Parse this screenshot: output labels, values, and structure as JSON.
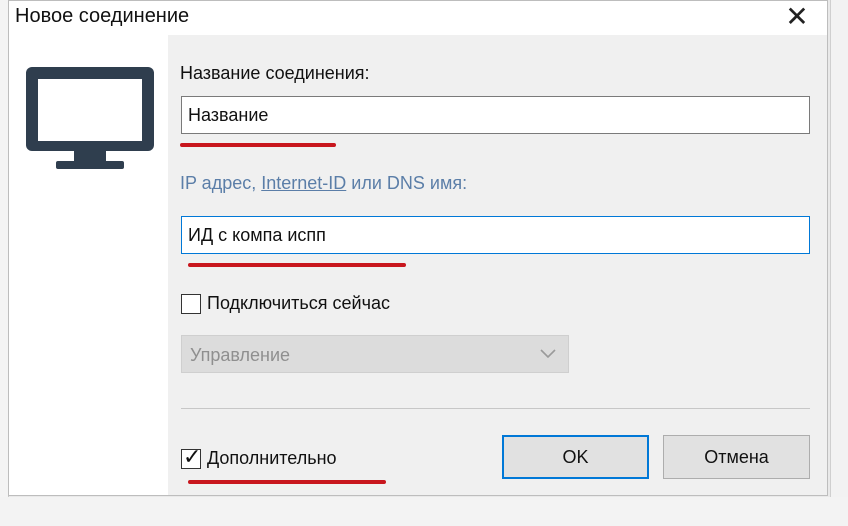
{
  "dialog": {
    "title": "Новое соединение",
    "close_glyph": "✕"
  },
  "icons": {
    "computer": "monitor-icon",
    "close": "close-icon",
    "dropdown": "chevron-down-icon",
    "check": "checkmark-icon"
  },
  "form": {
    "name_label": "Название соединения:",
    "name_value": "Название",
    "ip_label_prefix": "IP адрес,",
    "ip_label_link": "Internet-ID",
    "ip_label_suffix": "или DNS имя:",
    "id_value": "ИД с компа испп",
    "connect_now_label": "Подключиться сейчас",
    "connect_now_checked": false,
    "mode_value": "Управление",
    "advanced_label": "Дополнительно",
    "advanced_checked": true,
    "check_glyph": "✓"
  },
  "buttons": {
    "ok": "OK",
    "cancel": "Отмена"
  },
  "colors": {
    "accent": "#0078d7",
    "annotation_red": "#c8161d",
    "link": "#5b7ea8",
    "monitor": "#2f3e4e"
  }
}
